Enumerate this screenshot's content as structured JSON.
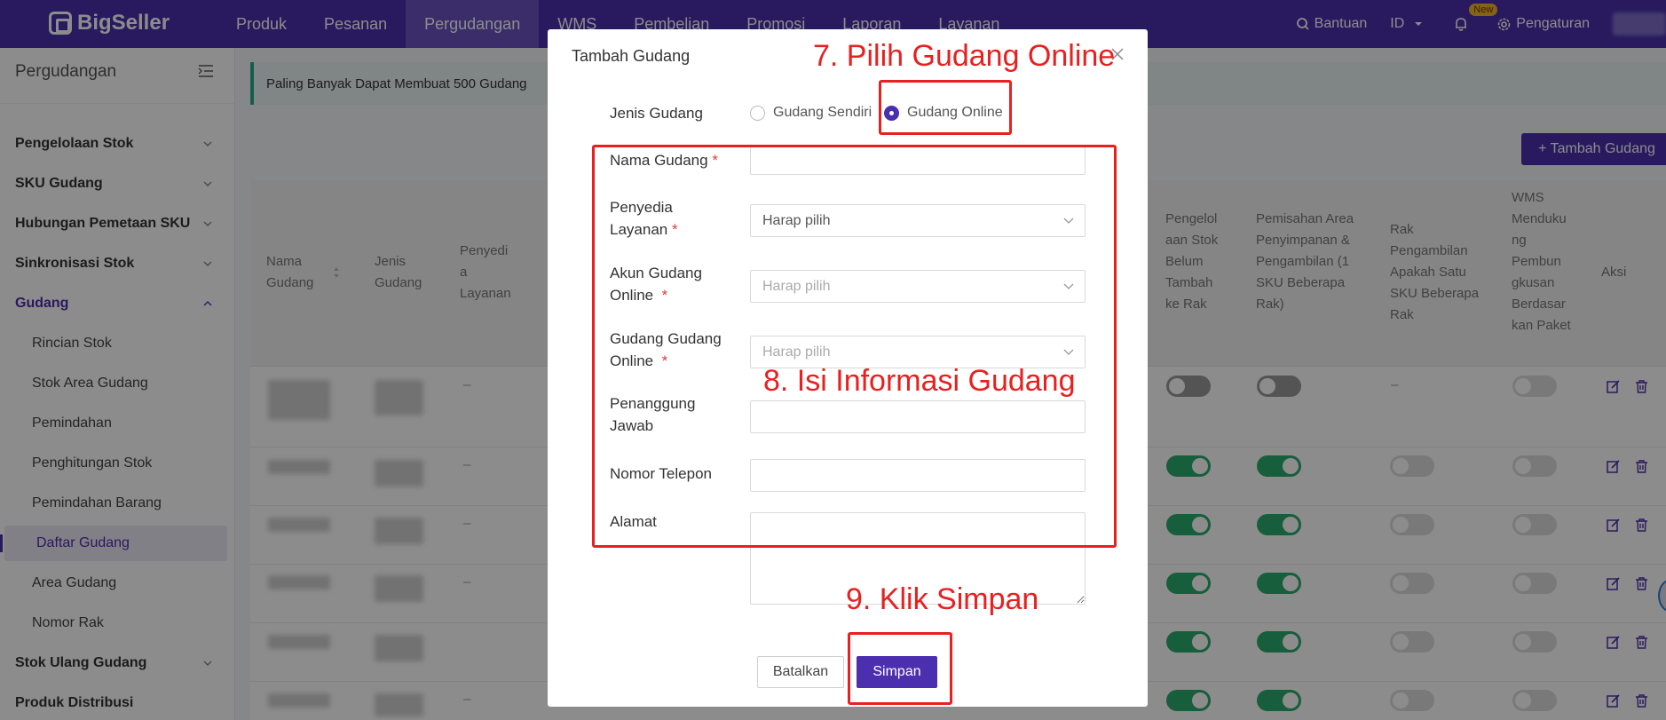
{
  "app": {
    "brand": "BigSeller"
  },
  "topnav": {
    "items": [
      "Produk",
      "Pesanan",
      "Pergudangan",
      "WMS",
      "Pembelian",
      "Promosi",
      "Laporan",
      "Layanan"
    ],
    "active": "Pergudangan",
    "help": "Bantuan",
    "lang": "ID",
    "new_badge": "New",
    "settings": "Pengaturan"
  },
  "sidebar": {
    "title": "Pergudangan",
    "groups": [
      "Pengelolaan Stok",
      "SKU Gudang",
      "Hubungan Pemetaan SKU",
      "Sinkronisasi Stok",
      "Gudang",
      "Stok Ulang Gudang",
      "Produk Distribusi"
    ],
    "sub_items": [
      "Rincian Stok",
      "Stok Area Gudang",
      "Pemindahan",
      "Penghitungan Stok",
      "Pemindahan Barang",
      "Daftar Gudang",
      "Area Gudang",
      "Nomor Rak"
    ],
    "active_sub": "Daftar Gudang"
  },
  "main": {
    "alert": "Paling Banyak Dapat Membuat 500 Gudang",
    "add_button": "+ Tambah Gudang",
    "columns": {
      "c1": "Nama Gudang",
      "c2": "Jenis Gudang",
      "c3": "Penyedi a Layanan",
      "c4": "Pengelol aan Stok Belum Tambah ke Rak",
      "c5": "Pemisahan Area Penyimpanan & Pengambilan (1 SKU Beberapa Rak)",
      "c6": "Rak Pengambilan Apakah Satu SKU Beberapa Rak",
      "c7": "WMS Menduku ng Pembun gkusan Berdasar kan Paket",
      "c8": "Aksi"
    },
    "dash": "–"
  },
  "modal": {
    "title": "Tambah Gudang",
    "warehouse_type_label": "Jenis Gudang",
    "radio_own": "Gudang Sendiri",
    "radio_online": "Gudang Online",
    "fields": {
      "name_label": "Nama Gudang",
      "provider_label_1": "Penyedia",
      "provider_label_2": "Layanan",
      "provider_placeholder": "Harap pilih",
      "account_label_1": "Akun Gudang",
      "account_label_2": "Online",
      "account_placeholder": "Harap pilih",
      "online_wh_label_1": "Gudang Gudang",
      "online_wh_label_2": "Online",
      "online_wh_placeholder": "Harap pilih",
      "pic_label_1": "Penanggung",
      "pic_label_2": "Jawab",
      "phone_label": "Nomor Telepon",
      "address_label": "Alamat"
    },
    "required_mark": "*",
    "cancel": "Batalkan",
    "save": "Simpan"
  },
  "annotations": {
    "step7": "7. Pilih Gudang Online",
    "step8": "8. Isi Informasi Gudang",
    "step9": "9. Klik Simpan",
    "color": "#e8201f"
  },
  "colors": {
    "brand": "#4c2fae",
    "toggle_on": "#2bab6e"
  }
}
